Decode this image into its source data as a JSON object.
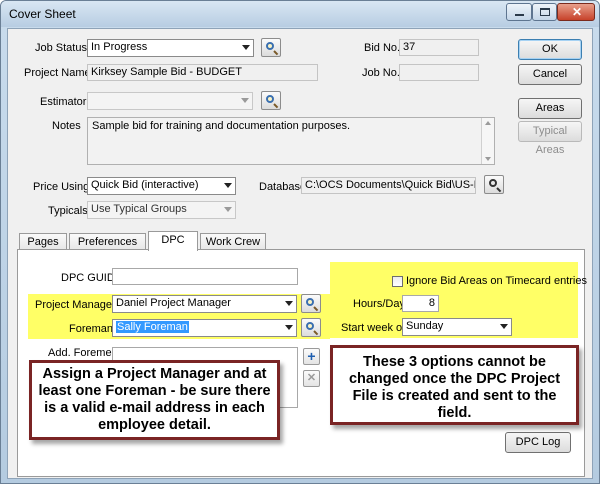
{
  "window": {
    "title": "Cover Sheet"
  },
  "header": {
    "job_status_label": "Job Status",
    "job_status_value": "In Progress",
    "project_name_label": "Project Name",
    "project_name_value": "Kirksey Sample Bid - BUDGET",
    "estimator_label": "Estimator",
    "estimator_value": "",
    "notes_label": "Notes",
    "notes_value": "Sample bid for training and documentation purposes.",
    "bid_no_label": "Bid No.",
    "bid_no_value": "37",
    "job_no_label": "Job No.",
    "job_no_value": "",
    "price_using_label": "Price Using",
    "price_using_value": "Quick Bid (interactive)",
    "database_label": "Database",
    "database_value": "C:\\OCS Documents\\Quick Bid\\US-Demo",
    "typicals_label": "Typicals",
    "typicals_value": "Use Typical Groups"
  },
  "buttons": {
    "ok": "OK",
    "cancel": "Cancel",
    "areas": "Areas",
    "typical_areas": "Typical Areas"
  },
  "tabs": [
    {
      "label": "Pages"
    },
    {
      "label": "Preferences"
    },
    {
      "label": "DPC"
    },
    {
      "label": "Work Crew"
    }
  ],
  "dpc": {
    "guid_label": "DPC GUID",
    "guid_value": "",
    "pm_label": "Project Manager",
    "pm_value": "Daniel Project Manager",
    "foreman_label": "Foreman",
    "foreman_value": "Sally Foreman",
    "add_foremen_label": "Add. Foremen",
    "ignore_label": "Ignore Bid Areas on Timecard entries",
    "ignore_checked": false,
    "hours_label": "Hours/Day",
    "hours_value": "8",
    "start_week_label": "Start week on",
    "start_week_value": "Sunday",
    "log_button": "DPC Log",
    "add_symbol": "+",
    "remove_symbol": "✕"
  },
  "callouts": {
    "left": "Assign a Project Manager and at least one Foreman - be sure there is a valid e-mail address in each employee detail.",
    "right": "These 3 options cannot be changed once the DPC Project File is created and sent to the field."
  },
  "colors": {
    "highlight": "#ffff66",
    "callout_border": "#7a2424",
    "selection": "#3399ff"
  }
}
